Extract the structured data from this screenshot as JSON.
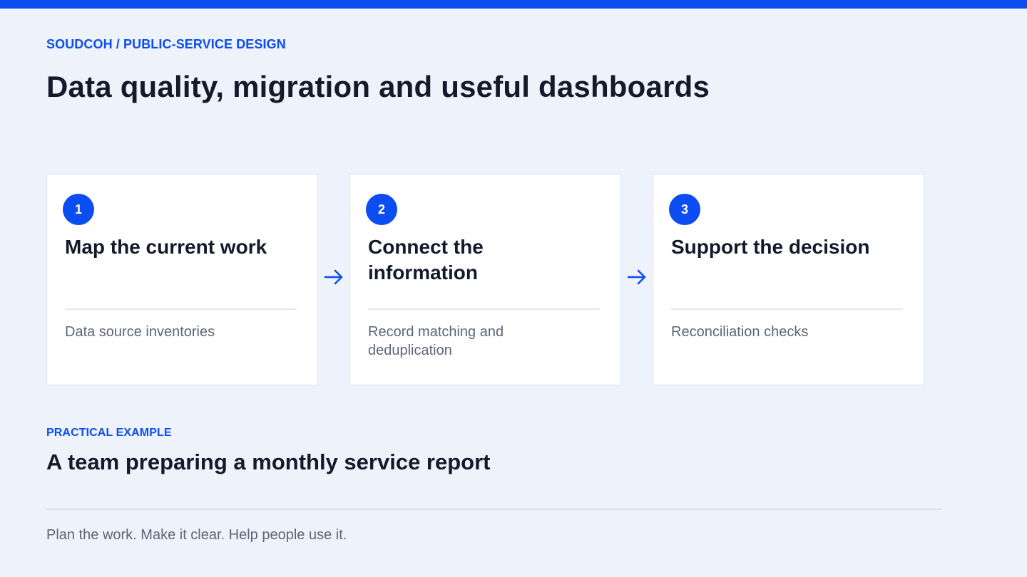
{
  "header": {
    "eyebrow": "SOUDCOH / PUBLIC-SERVICE DESIGN",
    "title": "Data quality, migration and useful dashboards"
  },
  "steps": [
    {
      "number": "1",
      "title": "Map the current work",
      "description": "Data source inventories"
    },
    {
      "number": "2",
      "title": "Connect the information",
      "description": "Record matching and deduplication"
    },
    {
      "number": "3",
      "title": "Support the decision",
      "description": "Reconciliation checks"
    }
  ],
  "example": {
    "label": "PRACTICAL EXAMPLE",
    "title": "A team preparing a monthly service report"
  },
  "footer": {
    "text": "Plan the work. Make it clear. Help people use it."
  },
  "colors": {
    "accent": "#0b4df0",
    "background": "#eef2fa",
    "card": "#ffffff",
    "text": "#141a2b",
    "muted": "#5e6578"
  },
  "icons": {
    "step_connector": "arrow-right-icon"
  }
}
